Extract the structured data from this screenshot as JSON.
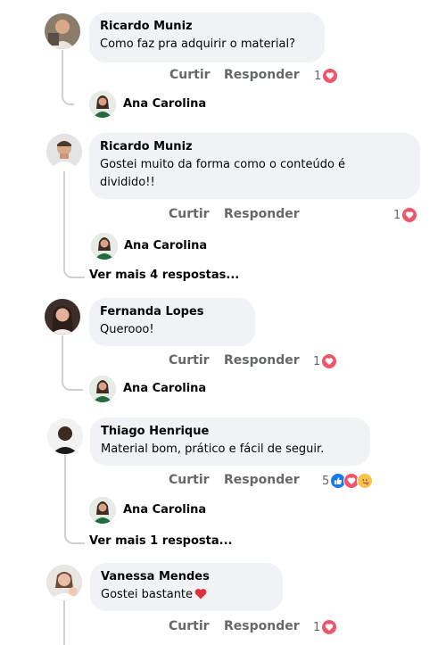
{
  "actions": {
    "like": "Curtir",
    "reply": "Responder"
  },
  "comments": [
    {
      "author": "Ricardo Muniz",
      "text": "Como faz pra adquirir o material?",
      "reaction_count": "1",
      "reply_author": "Ana Carolina"
    },
    {
      "author": "Ricardo Muniz",
      "text_line1": "Gostei muito da forma como o conteúdo é",
      "text_line2": "dividido!!",
      "reaction_count": "1",
      "reply_author": "Ana Carolina",
      "more_replies": "Ver mais 4 respostas..."
    },
    {
      "author": "Fernanda Lopes",
      "text": "Querooo!",
      "reaction_count": "1",
      "reply_author": "Ana Carolina"
    },
    {
      "author": "Thiago Henrique",
      "text": "Material bom, prático e fácil de seguir.",
      "reaction_count": "5",
      "reply_author": "Ana Carolina",
      "more_replies": "Ver mais 1 resposta..."
    },
    {
      "author": "Vanessa Mendes",
      "text": "Gostei bastante",
      "reaction_count": "1"
    }
  ],
  "colors": {
    "bubble": "#f0f2f5",
    "action_text": "#65676b",
    "heart": "#f0556a",
    "like": "#1877f2"
  },
  "icons": [
    "heart-reaction-icon",
    "like-reaction-icon",
    "care-reaction-icon",
    "red-heart-emoji-icon"
  ]
}
